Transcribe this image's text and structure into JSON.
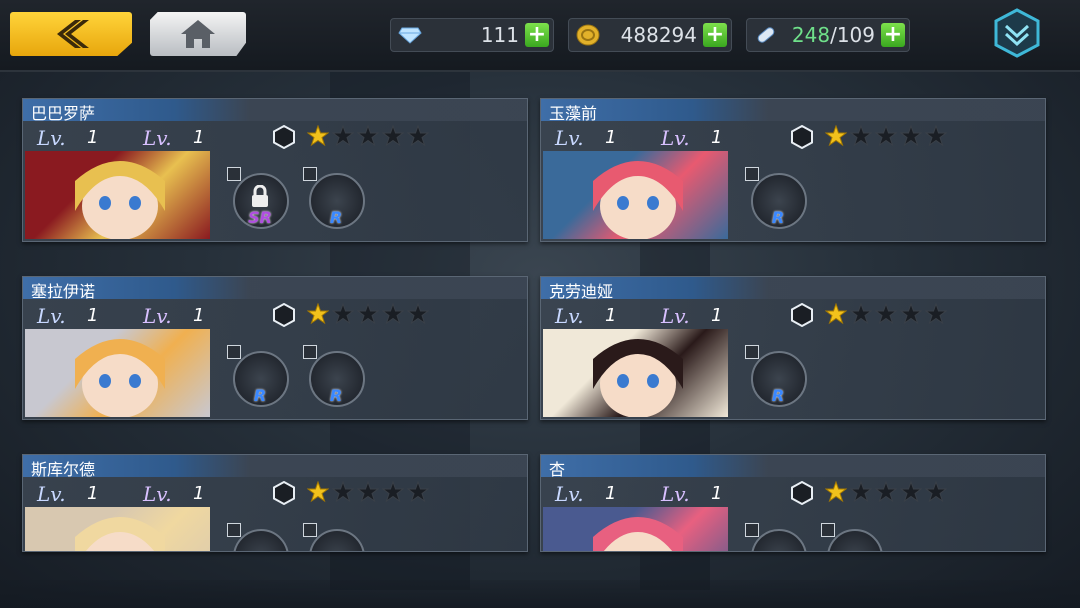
{
  "topbar": {
    "gems": "111",
    "gold": "488294",
    "stamina_current": "248",
    "stamina_max": "/109"
  },
  "characters": [
    {
      "name": "巴巴罗萨",
      "lv1": "1",
      "lv2": "1",
      "stars": 1,
      "equip": [
        "SR",
        "R"
      ],
      "portrait_hue": "#e8c050",
      "portrait_bg": "#8a1a20"
    },
    {
      "name": "玉藻前",
      "lv1": "1",
      "lv2": "1",
      "stars": 1,
      "equip": [
        "R"
      ],
      "portrait_hue": "#e85a70",
      "portrait_bg": "#3a6a9a"
    },
    {
      "name": "塞拉伊诺",
      "lv1": "1",
      "lv2": "1",
      "stars": 1,
      "equip": [
        "R",
        "R"
      ],
      "portrait_hue": "#f0b050",
      "portrait_bg": "#c8c8d0"
    },
    {
      "name": "克劳迪娅",
      "lv1": "1",
      "lv2": "1",
      "stars": 1,
      "equip": [
        "R"
      ],
      "portrait_hue": "#2a1a1a",
      "portrait_bg": "#f0e8d8"
    },
    {
      "name": "斯库尔德",
      "lv1": "1",
      "lv2": "1",
      "stars": 1,
      "equip": [
        "",
        ""
      ],
      "portrait_hue": "#f0d8a0",
      "portrait_bg": "#d8c8b0"
    },
    {
      "name": "杏",
      "lv1": "1",
      "lv2": "1",
      "stars": 1,
      "equip": [
        "",
        ""
      ],
      "portrait_hue": "#e86080",
      "portrait_bg": "#4a5a90"
    }
  ],
  "colors": {
    "star_on": "#f2c21c",
    "star_off": "#1a1e24",
    "accent_back": "#f2b71a",
    "plus_green": "#4cc42a"
  },
  "icons": [
    "back-arrow-icon",
    "home-icon",
    "gem-icon",
    "coin-icon",
    "stamina-pill-icon",
    "plus-icon",
    "chevron-menu-icon",
    "level-icon",
    "hexagon-icon",
    "star-icon",
    "lock-icon"
  ]
}
